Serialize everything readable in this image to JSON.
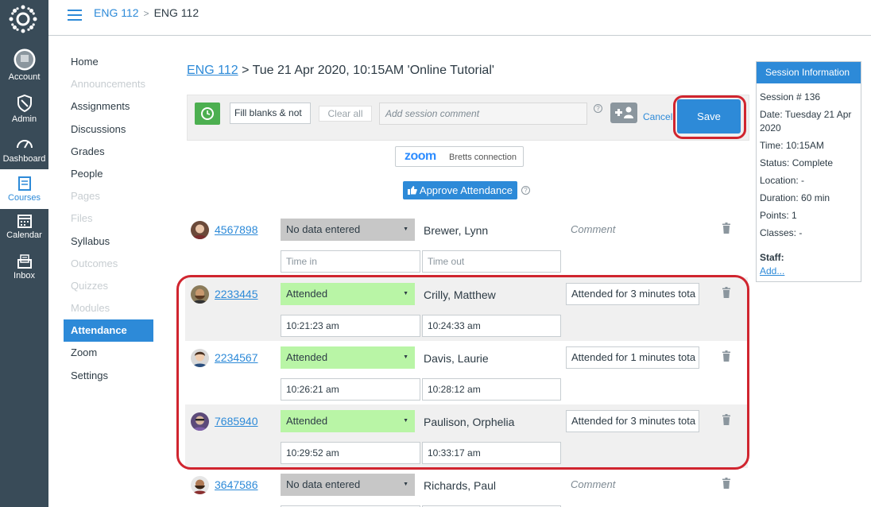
{
  "global_nav": [
    {
      "label": "Account",
      "icon": "account-icon"
    },
    {
      "label": "Admin",
      "icon": "admin-shield-icon"
    },
    {
      "label": "Dashboard",
      "icon": "dashboard-icon"
    },
    {
      "label": "Courses",
      "icon": "courses-book-icon",
      "active": true
    },
    {
      "label": "Calendar",
      "icon": "calendar-icon"
    },
    {
      "label": "Inbox",
      "icon": "inbox-icon"
    }
  ],
  "header": {
    "crumb1": "ENG 112",
    "crumb2": "ENG 112"
  },
  "course_nav": [
    {
      "label": "Home",
      "state": "normal"
    },
    {
      "label": "Announcements",
      "state": "dim"
    },
    {
      "label": "Assignments",
      "state": "normal"
    },
    {
      "label": "Discussions",
      "state": "normal"
    },
    {
      "label": "Grades",
      "state": "normal"
    },
    {
      "label": "People",
      "state": "normal"
    },
    {
      "label": "Pages",
      "state": "dim"
    },
    {
      "label": "Files",
      "state": "dim"
    },
    {
      "label": "Syllabus",
      "state": "normal"
    },
    {
      "label": "Outcomes",
      "state": "dim"
    },
    {
      "label": "Quizzes",
      "state": "dim"
    },
    {
      "label": "Modules",
      "state": "dim"
    },
    {
      "label": "Attendance",
      "state": "active"
    },
    {
      "label": "Zoom",
      "state": "normal"
    },
    {
      "label": "Settings",
      "state": "normal"
    }
  ],
  "page_title": {
    "course": "ENG 112",
    "rest": " > Tue 21 Apr 2020, 10:15AM 'Online Tutorial'"
  },
  "toolbar": {
    "fill_select": "Fill blanks & not",
    "clear_all": "Clear all",
    "comment_placeholder": "Add session comment",
    "help": "?",
    "cancel": "Cancel",
    "save": "Save"
  },
  "zoom": {
    "logo": "zoom",
    "connection": "Bretts connection"
  },
  "approve": {
    "label": "Approve Attendance",
    "help": "?"
  },
  "students": [
    {
      "id": "4567898",
      "status": "No data entered",
      "status_kind": "none",
      "name": "Brewer, Lynn",
      "comment": "Comment",
      "comment_is_placeholder": true,
      "time_in": "Time in",
      "time_out": "Time out",
      "times_are_placeholder": true,
      "shaded": false
    },
    {
      "id": "2233445",
      "status": "Attended",
      "status_kind": "att",
      "name": "Crilly, Matthew",
      "comment": "Attended for 3 minutes tota",
      "comment_is_placeholder": false,
      "time_in": "10:21:23 am",
      "time_out": "10:24:33 am",
      "times_are_placeholder": false,
      "shaded": true
    },
    {
      "id": "2234567",
      "status": "Attended",
      "status_kind": "att",
      "name": "Davis, Laurie",
      "comment": "Attended for 1 minutes tota",
      "comment_is_placeholder": false,
      "time_in": "10:26:21 am",
      "time_out": "10:28:12 am",
      "times_are_placeholder": false,
      "shaded": false
    },
    {
      "id": "7685940",
      "status": "Attended",
      "status_kind": "att",
      "name": "Paulison, Orphelia",
      "comment": "Attended for 3 minutes tota",
      "comment_is_placeholder": false,
      "time_in": "10:29:52 am",
      "time_out": "10:33:17 am",
      "times_are_placeholder": false,
      "shaded": true
    },
    {
      "id": "3647586",
      "status": "No data entered",
      "status_kind": "none",
      "name": "Richards, Paul",
      "comment": "Comment",
      "comment_is_placeholder": true,
      "time_in": "",
      "time_out": "",
      "times_are_placeholder": true,
      "shaded": false
    }
  ],
  "session_info": {
    "header": "Session Information",
    "number": "Session # 136",
    "date": "Date: Tuesday 21 Apr 2020",
    "time": "Time: 10:15AM",
    "status": "Status: Complete",
    "location": "Location: -",
    "duration": "Duration: 60 min",
    "points": "Points: 1",
    "classes": "Classes: -",
    "staff_label": "Staff:",
    "staff_add": "Add..."
  },
  "colors": {
    "brand_blue": "#2d8ad8",
    "nav_bg": "#394b58",
    "attended_green": "#b9f5a6",
    "highlight_red": "#d0252f"
  }
}
